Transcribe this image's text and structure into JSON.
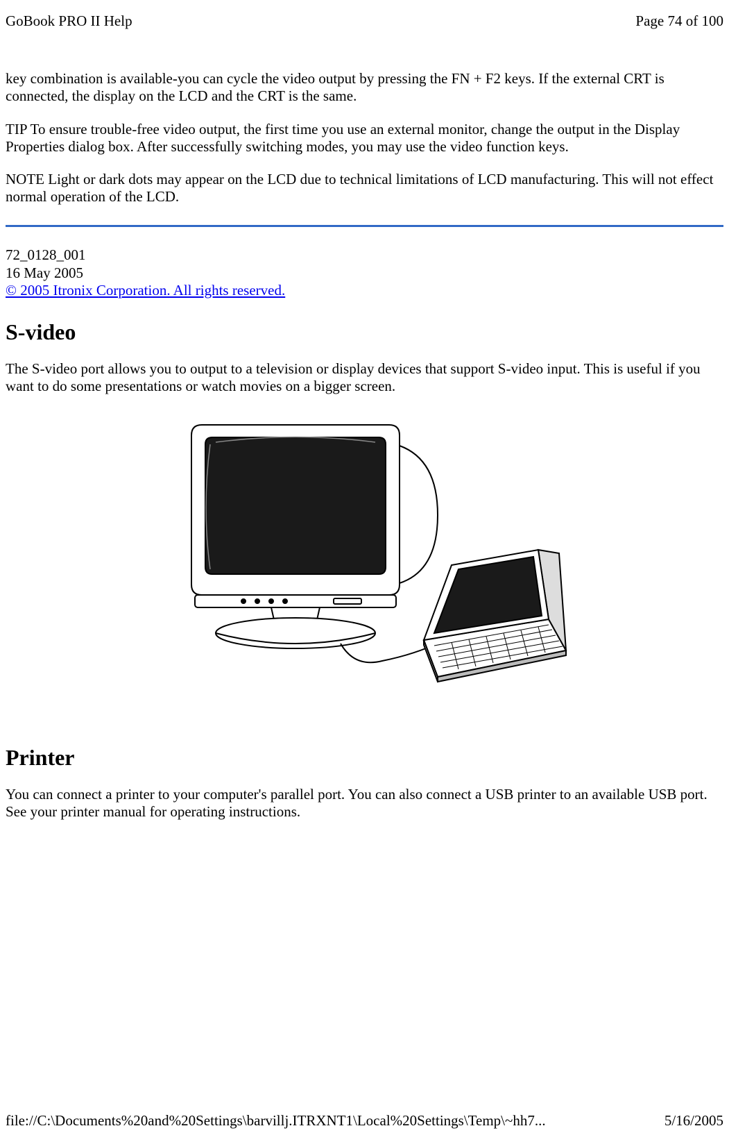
{
  "header": {
    "title": "GoBook PRO II Help",
    "page_indicator": "Page 74 of 100"
  },
  "body": {
    "p1": "key combination is available-you can cycle the video output by pressing the FN + F2 keys. If the external CRT is connected, the display on the LCD and the CRT is the same.",
    "p2": "TIP  To ensure trouble-free video output, the first time you use an external monitor, change the output in the Display Properties dialog box. After successfully switching modes, you may use the video function keys.",
    "p3": "NOTE  Light or dark dots may appear on the LCD due to technical limitations of LCD manufacturing. This will not effect normal operation of the LCD.",
    "doc_code": " 72_0128_001",
    "doc_date": "16 May 2005",
    "copyright": "© 2005 Itronix Corporation.  All rights reserved.",
    "h_svideo": "S-video",
    "p_svideo": "The S-video port allows you to output to a television or display devices that support S-video input. This is useful if you want to do some presentations or watch movies on a bigger screen.",
    "h_printer": "Printer",
    "p_printer": "You can connect a printer to your computer's parallel port. You can also connect a USB printer to an available USB port. See your printer manual for operating instructions."
  },
  "footer": {
    "path": "file://C:\\Documents%20and%20Settings\\barvillj.ITRXNT1\\Local%20Settings\\Temp\\~hh7...",
    "date": "5/16/2005"
  }
}
